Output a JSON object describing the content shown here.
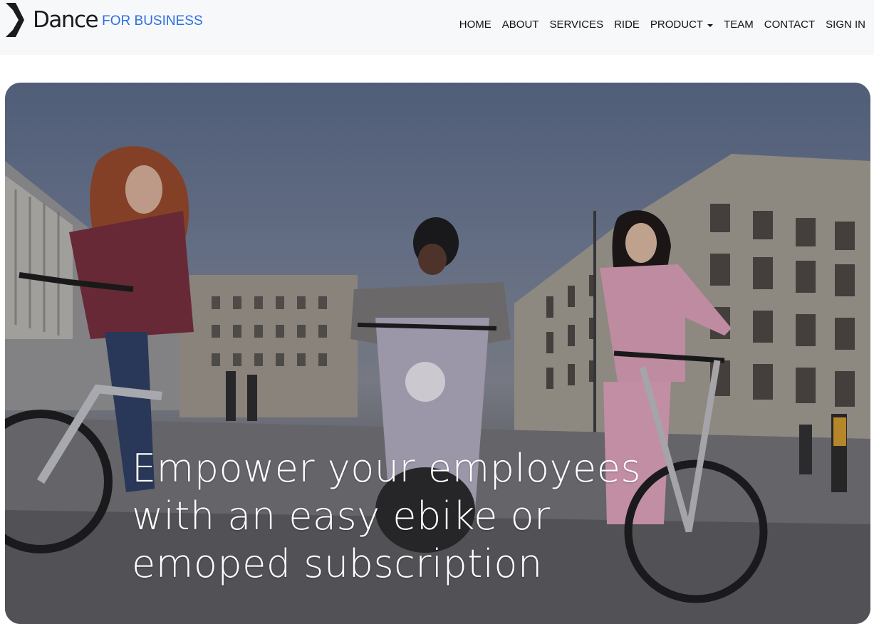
{
  "brand": {
    "name": "Dance",
    "sub": "FOR BUSINESS",
    "logo_icon": "dance-d-logo",
    "sub_color": "#2c6fe0"
  },
  "nav": {
    "items": [
      {
        "label": "HOME"
      },
      {
        "label": "ABOUT"
      },
      {
        "label": "SERVICES"
      },
      {
        "label": "RIDE"
      },
      {
        "label": "PRODUCT",
        "dropdown": true
      },
      {
        "label": "TEAM"
      },
      {
        "label": "CONTACT"
      },
      {
        "label": "SIGN IN"
      }
    ]
  },
  "hero": {
    "headline": "Empower your employees with an easy ebike or emoped subscription"
  }
}
